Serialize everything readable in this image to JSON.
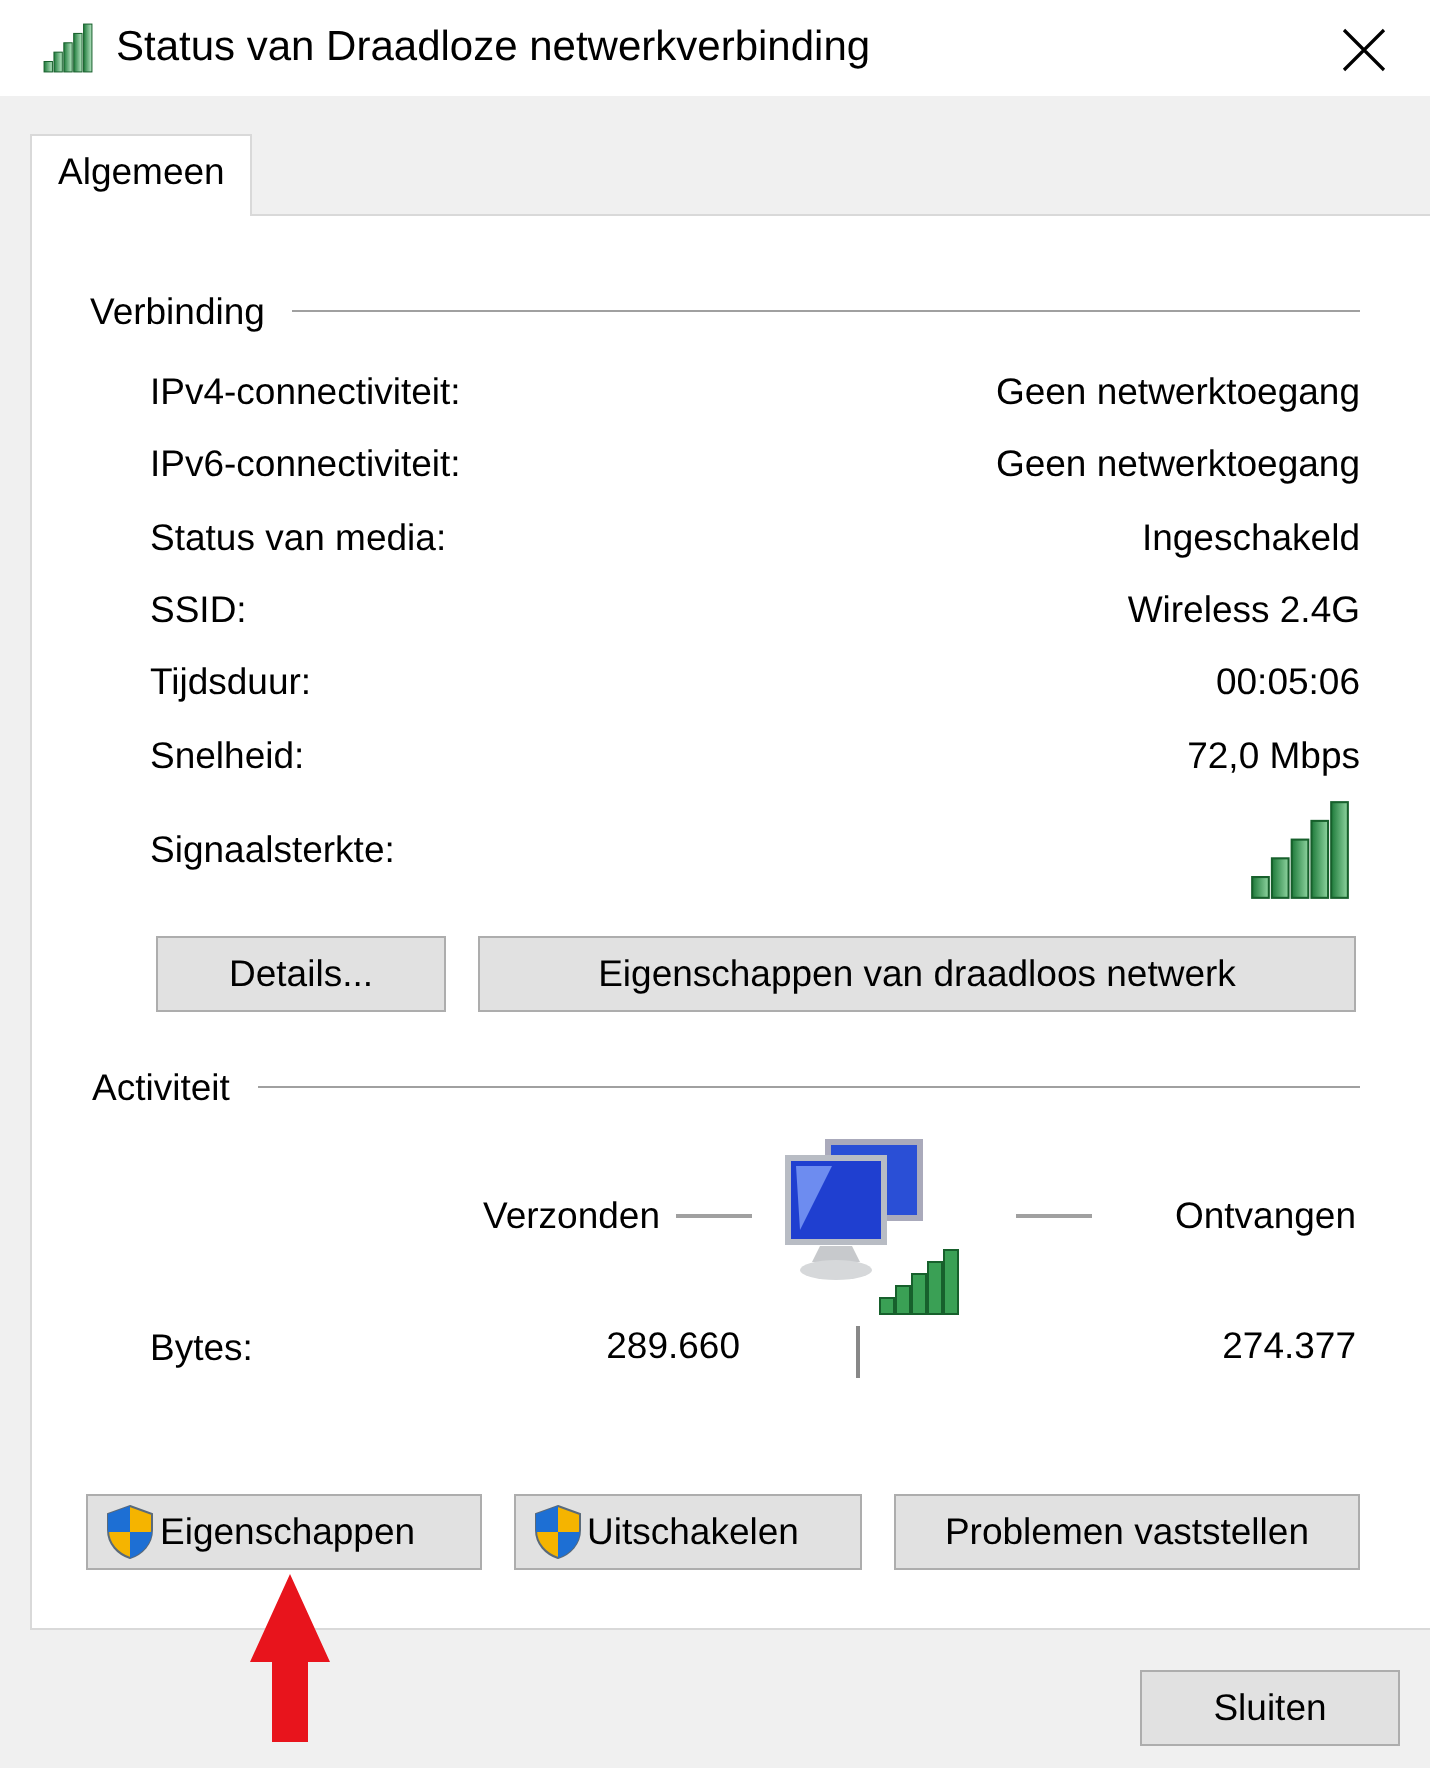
{
  "window": {
    "title": "Status van Draadloze netwerkverbinding"
  },
  "tabs": [
    {
      "label": "Algemeen",
      "selected": true
    }
  ],
  "connection": {
    "heading": "Verbinding",
    "rows": [
      {
        "label": "IPv4-connectiviteit:",
        "value": "Geen netwerktoegang"
      },
      {
        "label": "IPv6-connectiviteit:",
        "value": "Geen netwerktoegang"
      },
      {
        "label": "Status van media:",
        "value": "Ingeschakeld"
      },
      {
        "label": "SSID:",
        "value": "Wireless 2.4G"
      },
      {
        "label": "Tijdsduur:",
        "value": "00:05:06"
      },
      {
        "label": "Snelheid:",
        "value": "72,0 Mbps"
      }
    ],
    "signal_label": "Signaalsterkte:",
    "buttons": [
      "Details...",
      "Eigenschappen van draadloos netwerk"
    ]
  },
  "activity": {
    "heading": "Activiteit",
    "sent_label": "Verzonden",
    "received_label": "Ontvangen",
    "bytes_label": "Bytes:",
    "sent": "289.660",
    "received": "274.377"
  },
  "action_buttons": [
    {
      "label": "Eigenschappen",
      "shield": true
    },
    {
      "label": "Uitschakelen",
      "shield": true
    },
    {
      "label": "Problemen vaststellen",
      "shield": false
    }
  ],
  "close_button": "Sluiten"
}
